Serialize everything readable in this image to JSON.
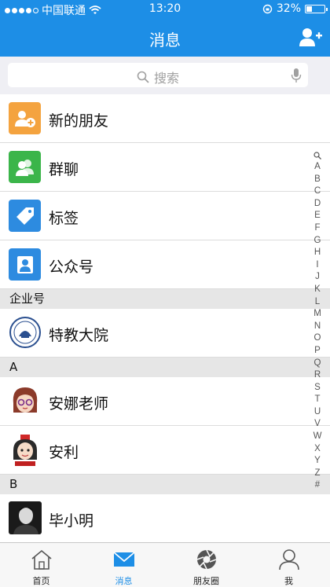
{
  "status": {
    "carrier": "中国联通",
    "time": "13:20",
    "battery": "32%",
    "battery_level": 0.32
  },
  "header": {
    "title": "消息"
  },
  "search": {
    "placeholder": "搜索"
  },
  "function_rows": [
    {
      "label": "新的朋友",
      "color": "#f4a33f",
      "icon": "new-friend-icon"
    },
    {
      "label": "群聊",
      "color": "#3bb54a",
      "icon": "group-chat-icon"
    },
    {
      "label": "标签",
      "color": "#2d8be0",
      "icon": "tag-icon"
    },
    {
      "label": "公众号",
      "color": "#2d8be0",
      "icon": "official-account-icon"
    }
  ],
  "sections": [
    {
      "header": "企业号",
      "contacts": [
        {
          "name": "特教大院",
          "avatar": "school-logo"
        }
      ]
    },
    {
      "header": "A",
      "contacts": [
        {
          "name": "安娜老师",
          "avatar": "cartoon-girl-glasses"
        },
        {
          "name": "安利",
          "avatar": "cartoon-girl-red"
        }
      ]
    },
    {
      "header": "B",
      "contacts": [
        {
          "name": "毕小明",
          "avatar": "photo-man"
        }
      ]
    }
  ],
  "index_letters": [
    "A",
    "B",
    "C",
    "D",
    "E",
    "F",
    "G",
    "H",
    "I",
    "J",
    "K",
    "L",
    "M",
    "N",
    "O",
    "P",
    "Q",
    "R",
    "S",
    "T",
    "U",
    "V",
    "W",
    "X",
    "Y",
    "Z",
    "#"
  ],
  "tabs": [
    {
      "label": "首页",
      "icon": "home-icon",
      "active": false
    },
    {
      "label": "消息",
      "icon": "mail-icon",
      "active": true
    },
    {
      "label": "朋友圈",
      "icon": "aperture-icon",
      "active": false
    },
    {
      "label": "我",
      "icon": "person-icon",
      "active": false
    }
  ],
  "colors": {
    "accent": "#1d8ee6",
    "section_bg": "#e6e6e6"
  }
}
